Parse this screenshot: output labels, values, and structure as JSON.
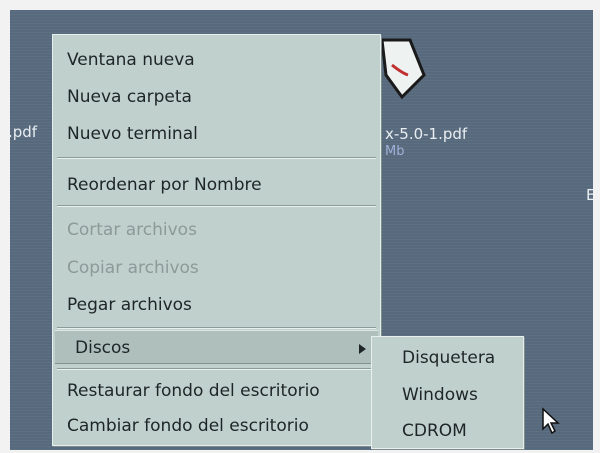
{
  "desktop": {
    "left_file_label": ".pdf",
    "right_file_label": "x-5.0-1.pdf",
    "right_file_sub": "Mb",
    "edge_label": "E"
  },
  "context_menu": {
    "items": [
      {
        "label": "Ventana nueva",
        "enabled": true
      },
      {
        "label": "Nueva carpeta",
        "enabled": true
      },
      {
        "label": "Nuevo terminal",
        "enabled": true
      },
      {
        "label": "Reordenar por Nombre",
        "enabled": true
      },
      {
        "label": "Cortar archivos",
        "enabled": false
      },
      {
        "label": "Copiar archivos",
        "enabled": false
      },
      {
        "label": "Pegar archivos",
        "enabled": true
      },
      {
        "label": "Discos",
        "enabled": true,
        "has_submenu": true,
        "highlighted": true
      },
      {
        "label": "Restaurar fondo del escritorio",
        "enabled": true
      },
      {
        "label": "Cambiar fondo del escritorio",
        "enabled": true
      }
    ]
  },
  "submenu": {
    "items": [
      {
        "label": "Disquetera"
      },
      {
        "label": "Windows"
      },
      {
        "label": "CDROM"
      }
    ]
  },
  "colors": {
    "desktop_bg": "#57697c",
    "menu_bg": "#c0d0cd",
    "menu_text": "#1e2526",
    "disabled_text": "#8c9a98"
  },
  "icons": [
    "pdf-file-icon",
    "submenu-arrow-icon",
    "mouse-pointer-icon"
  ]
}
